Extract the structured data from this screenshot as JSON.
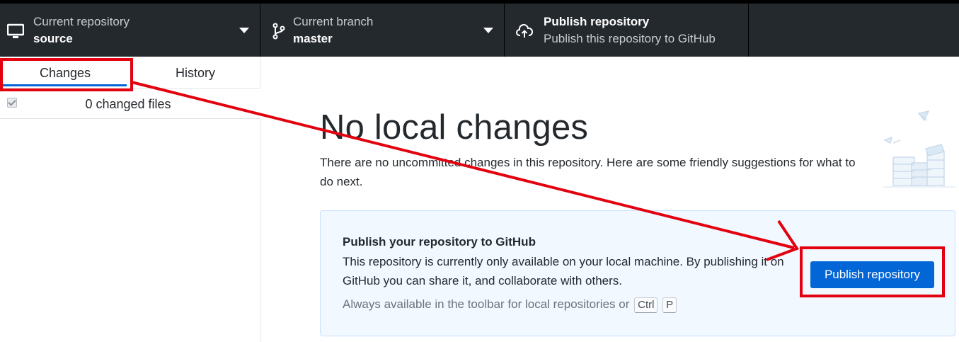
{
  "toolbar": {
    "repository": {
      "title": "Current repository",
      "value": "source"
    },
    "branch": {
      "title": "Current branch",
      "value": "master"
    },
    "publish": {
      "title": "Publish repository",
      "subtitle": "Publish this repository to GitHub"
    }
  },
  "sidebar": {
    "tabs": [
      {
        "label": "Changes"
      },
      {
        "label": "History"
      }
    ],
    "changed_files": "0 changed files"
  },
  "main": {
    "heading": "No local changes",
    "description": "There are no uncommitted changes in this repository. Here are some friendly suggestions for what to do next.",
    "publish_card": {
      "title": "Publish your repository to GitHub",
      "text": "This repository is currently only available on your local machine. By publishing it on GitHub you can share it, and collaborate with others.",
      "hint": "Always available in the toolbar for local repositories or",
      "shortcut_keys": [
        "Ctrl",
        "P"
      ],
      "button_label": "Publish repository"
    }
  },
  "colors": {
    "toolbar_bg": "#24292e",
    "accent": "#0366d6",
    "annotation": "#e3000f",
    "card_bg": "#f1f8ff"
  },
  "icons": [
    "desktop-icon",
    "branch-icon",
    "cloud-upload-icon",
    "chevron-down-icon",
    "illustration"
  ]
}
